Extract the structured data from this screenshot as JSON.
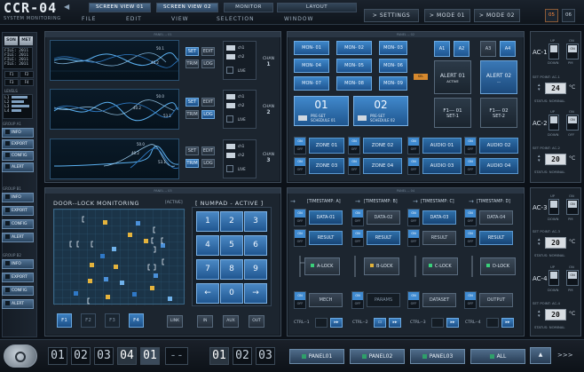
{
  "app": {
    "title": "CCR-04",
    "subtitle": "SYSTEM MONITORING"
  },
  "top_tabs": [
    "SCREEN VIEW 01",
    "SCREEN VIEW 02",
    "MONITOR",
    "LAYOUT"
  ],
  "menu": [
    "FILE",
    "EDIT",
    "VIEW",
    "SELECTION",
    "WINDOW"
  ],
  "header_buttons": {
    "settings": "SETTINGS",
    "mode1": "MODE 01",
    "mode2": "MODE 02",
    "sq1": "05",
    "sq2": "06"
  },
  "sidebar": {
    "top_buttons": [
      "SON",
      "MET"
    ],
    "lcd1": [
      "FILE: 2011",
      "FILE: 2011",
      "FILE: 2011",
      "FILE: 2011"
    ],
    "mini_buttons": [
      "F1",
      "F2",
      "F3",
      "F4"
    ],
    "levels_label": "LEVELS",
    "levels": [
      "L1",
      "L2",
      "L3",
      "L4"
    ],
    "group_a": "GROUP A1",
    "group_b": "GROUP B1",
    "group_c": "GROUP B2",
    "items": [
      "INFO",
      "EXPORT",
      "CONFIG",
      "ALERT"
    ]
  },
  "panel_titles": {
    "wave": "PANEL -- 01",
    "mon": "PANEL -- 02",
    "door": "PANEL -- 03",
    "seq": "PANEL -- 04"
  },
  "wave": {
    "rows": [
      {
        "v1": "50.1",
        "v2": "40.2",
        "v3": "53.1",
        "chan": "CHAN",
        "num": "1"
      },
      {
        "v1": "50.0",
        "v2": "40.2",
        "v3": "53.1",
        "chan": "CHAN",
        "num": "2"
      },
      {
        "v1": "50.0",
        "v2": "40.2",
        "v3": "53.1",
        "chan": "CHAN",
        "num": "3"
      }
    ],
    "set": "SET",
    "edit": "EDIT",
    "trim": "TRIM",
    "log": "LOG",
    "switch_on": "ON",
    "switch_off": "OFF",
    "ch1": "ch1",
    "ch2": "ch2",
    "live": "LIVE"
  },
  "monitor": {
    "mons": [
      "MON- 01",
      "MON- 02",
      "MON- 03",
      "MON- 04",
      "MON- 05",
      "MON- 06",
      "MON- 07",
      "MON- 08",
      "MON- 09"
    ],
    "big1": {
      "num": "01",
      "label": "PRE-SET",
      "sub": "SCHEDULE 01"
    },
    "big2": {
      "num": "02",
      "label": "PRE-SET",
      "sub": "SCHEDULE 02"
    },
    "sel": "SEL",
    "a": [
      "A1",
      "A2",
      "A3",
      "A4"
    ],
    "alert1": {
      "title": "ALERT 01",
      "status": "ACTIVE"
    },
    "alert2": {
      "title": "ALERT 02",
      "status": "---"
    },
    "f1": {
      "title": "F1--- 01",
      "sub": "SET-1"
    },
    "f2": {
      "title": "F1--- 02",
      "sub": "SET-2"
    },
    "zones": [
      "ZONE 01",
      "ZONE 02",
      "ZONE 03",
      "ZONE 04"
    ],
    "audios": [
      "AUDIO 01",
      "AUDIO 02",
      "AUDIO 03",
      "AUDIO 04"
    ]
  },
  "door": {
    "title": "DOOR--LOCK MONITORING",
    "tag": "[ACTIVE]",
    "numpad_title": "[ NUMPAD - ACTIVE ]",
    "keys": [
      "1",
      "2",
      "3",
      "4",
      "5",
      "6",
      "7",
      "8",
      "9",
      "←",
      "0",
      "→"
    ],
    "fkeys": [
      "F1",
      "F2",
      "F3",
      "F4"
    ],
    "actions": [
      "LINK",
      "IN",
      "AUX",
      "OUT"
    ]
  },
  "sequence": {
    "timestamps": [
      "[TIMESTAMP: A]",
      "[TIMESTAMP: B]",
      "[TIMESTAMP: C]",
      "[TIMESTAMP: D]"
    ],
    "data": [
      "DATA-01",
      "DATA-02",
      "DATA-03",
      "DATA-04"
    ],
    "result": [
      "RESULT",
      "RESULT",
      "RESULT",
      "RESULT"
    ],
    "locks": [
      "A-LOCK",
      "B-LOCK",
      "C-LOCK",
      "D-LOCK"
    ],
    "bottom": [
      "MECH",
      "PARAMS",
      "DATASET",
      "OUTPUT"
    ],
    "ctrls": [
      "CTRL--1",
      "CTRL--2",
      "CTRL--3",
      "CTRL--4"
    ]
  },
  "climate": [
    {
      "name": "AC-1",
      "temp": "24",
      "unit": "°C",
      "sp": "SET POINT: AC-1",
      "status": "STATUS: NOMINAL"
    },
    {
      "name": "AC-2",
      "temp": "20",
      "unit": "°C",
      "sp": "SET POINT: AC-2",
      "status": "STATUS: NOMINAL"
    },
    {
      "name": "AC-3",
      "temp": "20",
      "unit": "°C",
      "sp": "SET POINT: AC-3",
      "status": "STATUS: NOMINAL"
    },
    {
      "name": "AC-4",
      "temp": "20",
      "unit": "°C",
      "sp": "SET POINT: AC-4",
      "status": "STATUS: NOMINAL"
    }
  ],
  "climate_labels": {
    "up": "UP",
    "down": "DOWN",
    "on": "ON",
    "pm": "PM",
    "off": "OFF"
  },
  "bottom": {
    "seg1": [
      "01",
      "02",
      "03",
      "04",
      "01",
      "--"
    ],
    "seg2": [
      "01",
      "02",
      "03"
    ],
    "tabs": [
      "PANEL01",
      "PANEL02",
      "PANEL03",
      "ALL"
    ],
    "more": ">>>"
  }
}
